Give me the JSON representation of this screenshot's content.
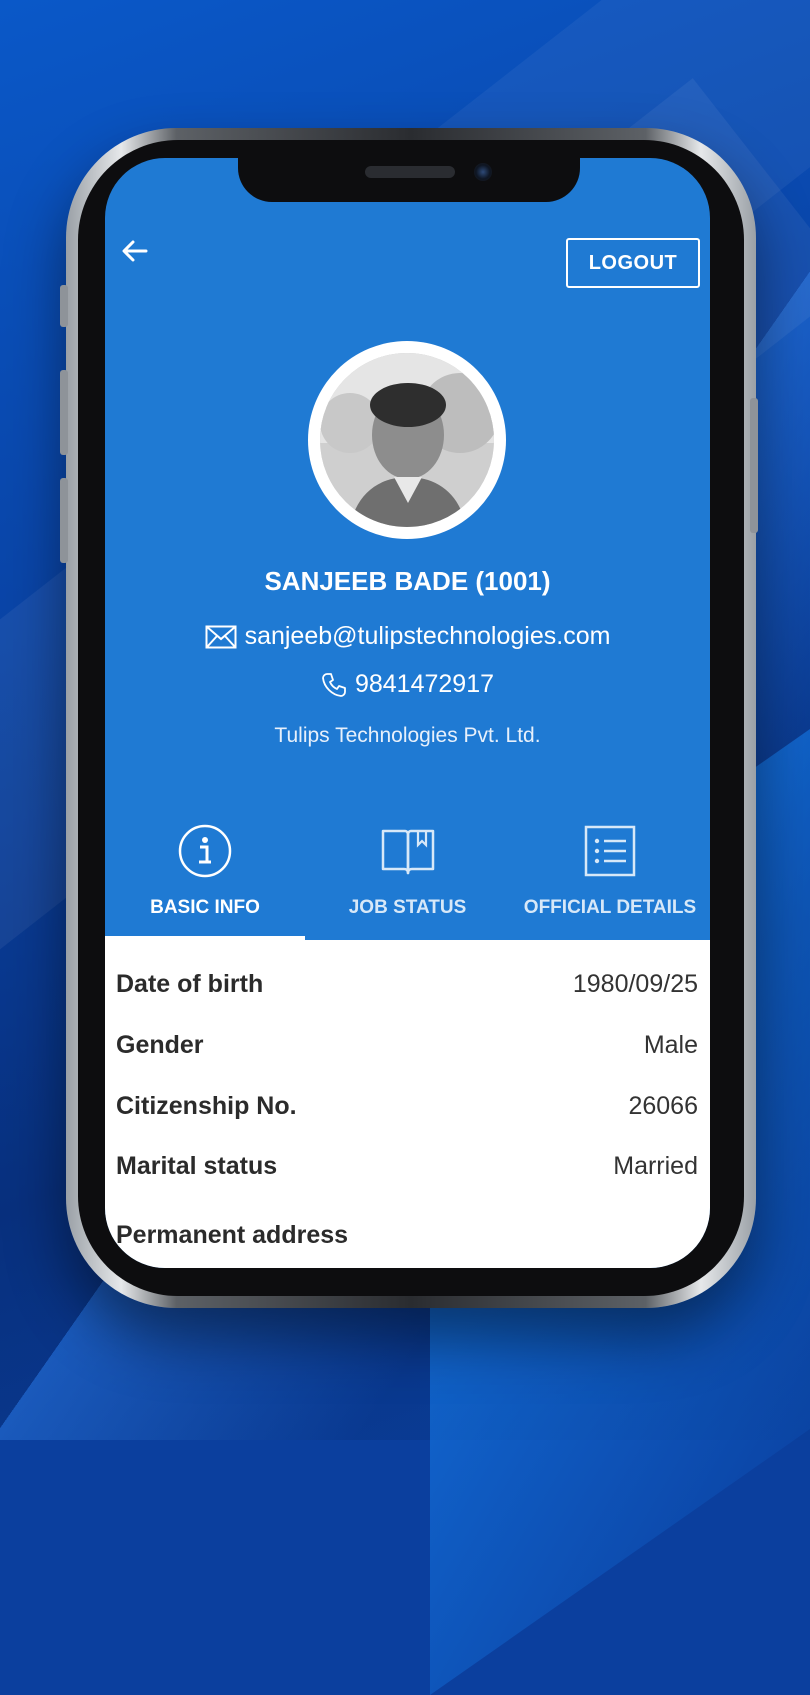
{
  "header": {
    "back_icon": "arrow-left-icon",
    "logout_label": "LOGOUT"
  },
  "profile": {
    "name": "SANJEEB BADE (1001)",
    "email": "sanjeeb@tulipstechnologies.com",
    "phone": "9841472917",
    "company": "Tulips Technologies Pvt. Ltd."
  },
  "tabs": [
    {
      "label": "BASIC INFO",
      "icon": "info-circle-icon",
      "active": true
    },
    {
      "label": "JOB STATUS",
      "icon": "book-icon",
      "active": false
    },
    {
      "label": "OFFICIAL DETAILS",
      "icon": "list-icon",
      "active": false
    }
  ],
  "basic_info": [
    {
      "label": "Date of birth",
      "value": "1980/09/25"
    },
    {
      "label": "Gender",
      "value": "Male"
    },
    {
      "label": "Citizenship No.",
      "value": "26066"
    },
    {
      "label": "Marital status",
      "value": "Married"
    },
    {
      "label": "Permanent address",
      "value": ""
    }
  ],
  "colors": {
    "primary": "#1f7ad3",
    "background_dark": "#0b3f9e",
    "surface": "#ffffff"
  }
}
